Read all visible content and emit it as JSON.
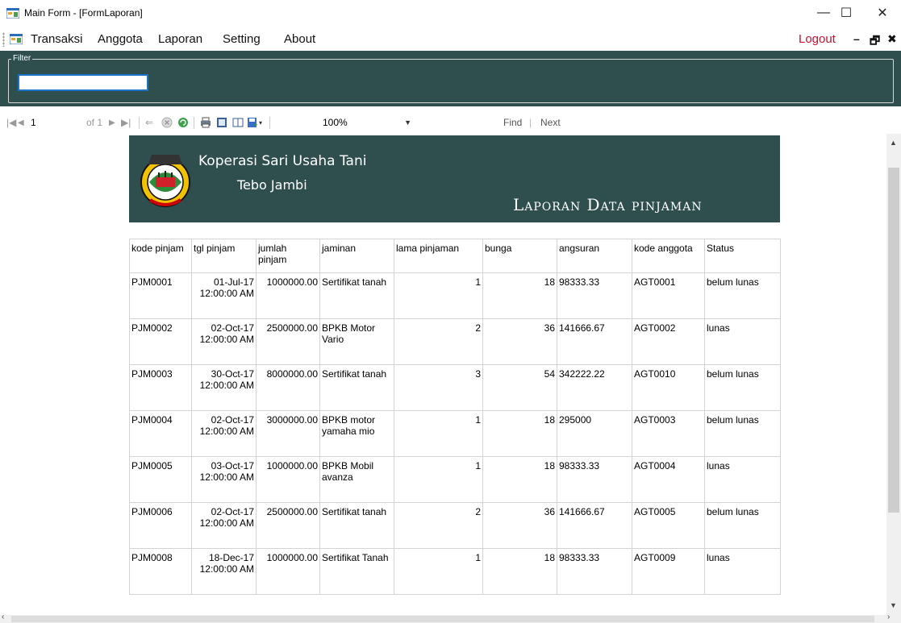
{
  "window": {
    "title": "Main Form - [FormLaporan]",
    "minimize": "—",
    "maximize": "☐",
    "close": "✕"
  },
  "menu": {
    "items": [
      "Transaksi",
      "Anggota",
      "Laporan",
      "Setting",
      "About"
    ],
    "logout": "Logout",
    "mdi_min": "–",
    "mdi_restore": "🗗",
    "mdi_close": "✖",
    "logout_color": "#c8102e"
  },
  "filter": {
    "legend": "Filter",
    "value": ""
  },
  "toolbar": {
    "page_current": "1",
    "page_of": "of 1",
    "zoom": "100%",
    "find": "Find",
    "separator": "|",
    "next": "Next"
  },
  "report": {
    "org_name": "Koperasi Sari Usaha Tani",
    "org_city": "Tebo Jambi",
    "title": "Laporan Data pinjaman",
    "header_color": "#2f4f4f",
    "columns": [
      "kode pinjam",
      "tgl pinjam",
      "jumlah pinjam",
      "jaminan",
      "lama pinjaman",
      "bunga",
      "angsuran",
      "kode anggota",
      "Status"
    ],
    "rows": [
      [
        "PJM0001",
        "01-Jul-17 12:00:00 AM",
        "1000000.00",
        "Sertifikat tanah",
        "1",
        "18",
        "98333.33",
        "AGT0001",
        "belum lunas"
      ],
      [
        "PJM0002",
        "02-Oct-17 12:00:00 AM",
        "2500000.00",
        "BPKB Motor Vario",
        "2",
        "36",
        "141666.67",
        "AGT0002",
        "lunas"
      ],
      [
        "PJM0003",
        "30-Oct-17 12:00:00 AM",
        "8000000.00",
        "Sertifikat tanah",
        "3",
        "54",
        "342222.22",
        "AGT0010",
        "belum lunas"
      ],
      [
        "PJM0004",
        "02-Oct-17 12:00:00 AM",
        "3000000.00",
        "BPKB motor yamaha mio",
        "1",
        "18",
        "295000",
        "AGT0003",
        "belum lunas"
      ],
      [
        "PJM0005",
        "03-Oct-17 12:00:00 AM",
        "1000000.00",
        "BPKB Mobil avanza",
        "1",
        "18",
        "98333.33",
        "AGT0004",
        "lunas"
      ],
      [
        "PJM0006",
        "02-Oct-17 12:00:00 AM",
        "2500000.00",
        "Sertifikat tanah",
        "2",
        "36",
        "141666.67",
        "AGT0005",
        "belum lunas"
      ],
      [
        "PJM0008",
        "18-Dec-17 12:00:00 AM",
        "1000000.00",
        "Sertifikat Tanah",
        "1",
        "18",
        "98333.33",
        "AGT0009",
        "lunas"
      ]
    ]
  }
}
